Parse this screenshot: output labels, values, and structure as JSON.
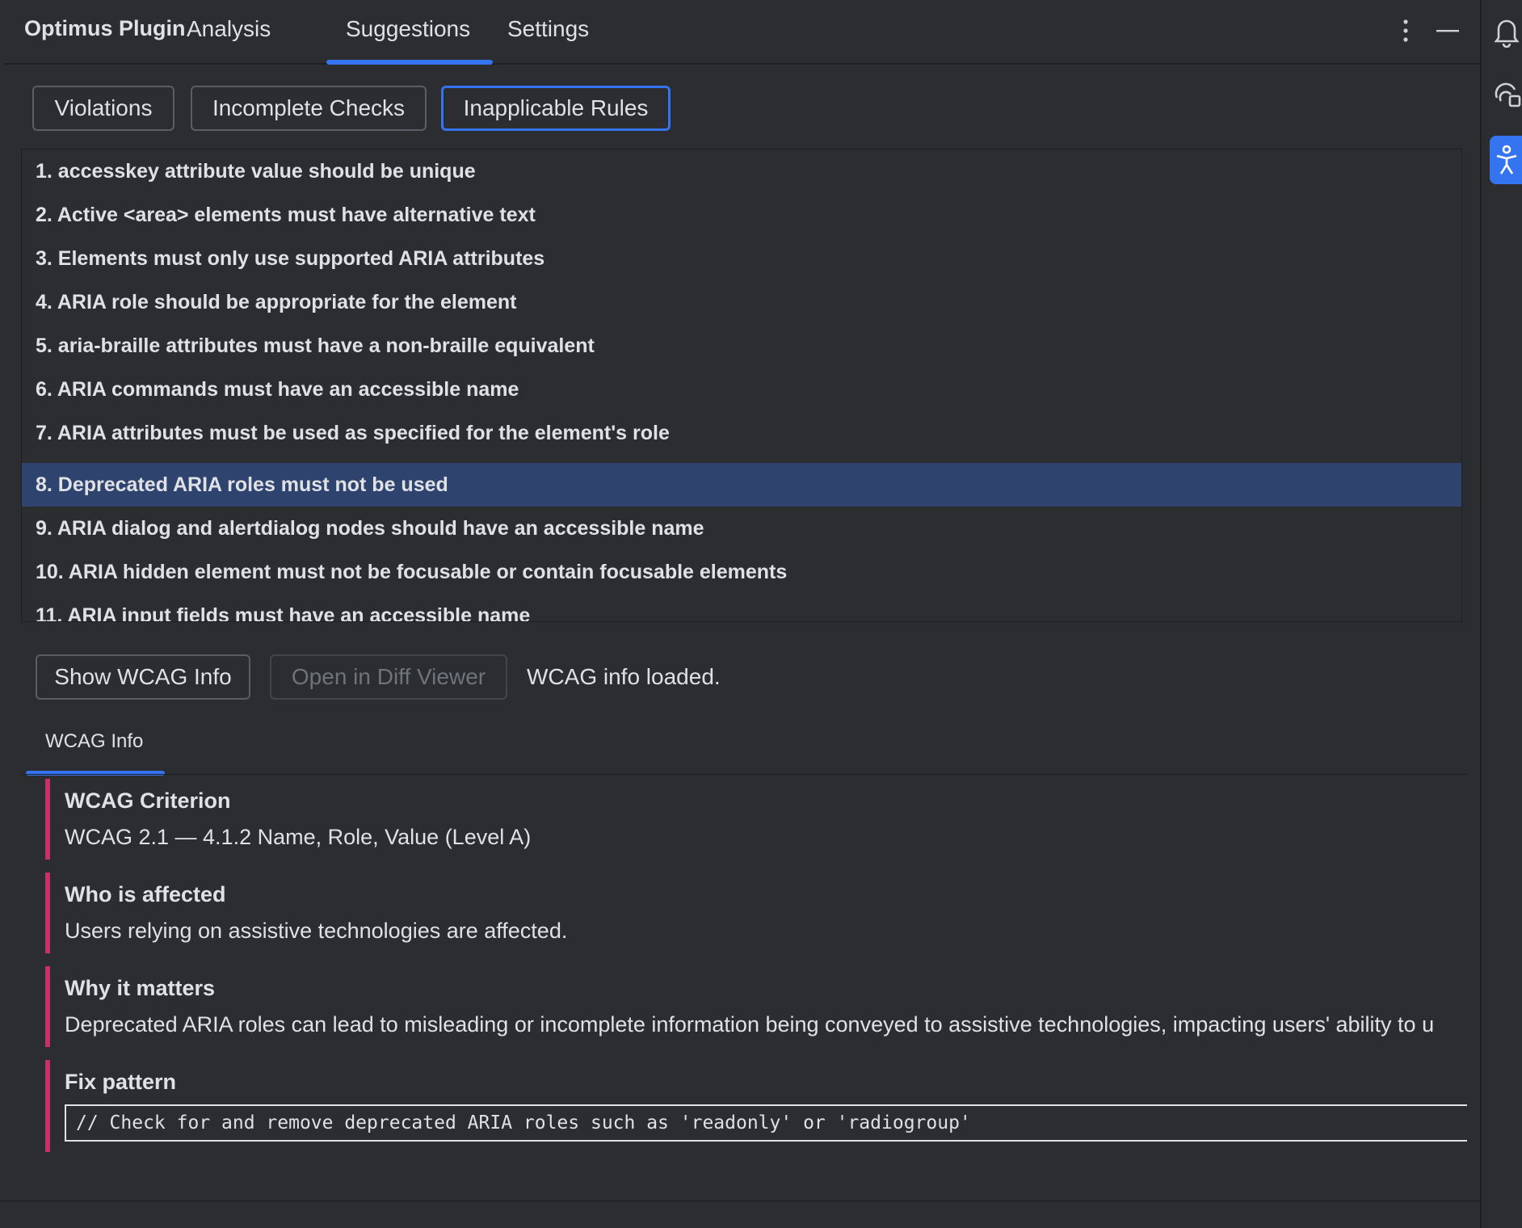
{
  "header": {
    "title": "Optimus Plugin",
    "tabs": [
      {
        "label": "Analysis"
      },
      {
        "label": "Suggestions",
        "active": true
      },
      {
        "label": "Settings"
      }
    ],
    "icons": [
      "more-vertical-icon",
      "minimize-icon"
    ]
  },
  "sub_tabs": [
    {
      "label": "Violations"
    },
    {
      "label": "Incomplete Checks"
    },
    {
      "label": "Inapplicable Rules",
      "active": true
    }
  ],
  "rules": [
    "1. accesskey attribute value should be unique",
    "2. Active <area> elements must have alternative text",
    "3. Elements must only use supported ARIA attributes",
    "4. ARIA role should be appropriate for the element",
    "5. aria-braille attributes must have a non-braille equivalent",
    "6. ARIA commands must have an accessible name",
    "7. ARIA attributes must be used as specified for the element's role",
    "8. Deprecated ARIA roles must not be used",
    "9. ARIA dialog and alertdialog nodes should have an accessible name",
    "10. ARIA hidden element must not be focusable or contain focusable elements",
    "11. ARIA input fields must have an accessible name"
  ],
  "selected_rule_index": 7,
  "actions": {
    "show_wcag": "Show WCAG Info",
    "open_diff": "Open in Diff Viewer",
    "status": "WCAG info loaded."
  },
  "wcag": {
    "tab_label": "WCAG Info",
    "criterion_title": "WCAG Criterion",
    "criterion_text": "WCAG 2.1 — 4.1.2 Name, Role, Value (Level A)",
    "affected_title": "Who is affected",
    "affected_text": "Users relying on assistive technologies are affected.",
    "why_title": "Why it matters",
    "why_text": "Deprecated ARIA roles can lead to misleading or incomplete information being conveyed to assistive technologies, impacting users' ability to u",
    "fix_title": "Fix pattern",
    "fix_code": "// Check for and remove deprecated ARIA roles such as 'readonly' or 'radiogroup'"
  },
  "right_toolbar": {
    "icons": [
      "notifications-icon",
      "ai-assistant-icon",
      "accessibility-icon"
    ]
  },
  "colors": {
    "background": "#2b2d30",
    "accent": "#3574f0",
    "selection": "#2e436e",
    "info_border": "#c8306b"
  }
}
